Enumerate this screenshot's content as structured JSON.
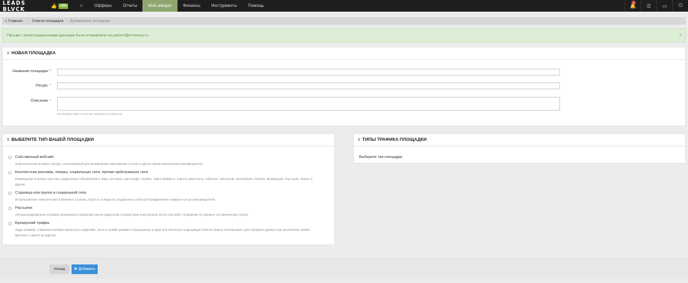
{
  "topbar": {
    "logo": "LEADS BLVCK",
    "like_pct": "+5%",
    "nav": [
      "Офферы",
      "Отчеты",
      "Мой аккаунт",
      "Финансы",
      "Инструменты",
      "Помощь"
    ],
    "notification_count": "2"
  },
  "breadcrumb": {
    "home": "Главная",
    "list": "Список площадок",
    "current": "Добавление площадки"
  },
  "alert": {
    "text": "Письмо с регистрационными данными было отправлено на partner@m-money.ru"
  },
  "new_site": {
    "title": "НОВАЯ ПЛОЩАДКА",
    "name_label": "Название площадки",
    "resource_label": "Ресурс",
    "description_label": "Описание",
    "required_mark": "*",
    "description_hint": "необходимо ввести еще как минимум 30 символов"
  },
  "site_type": {
    "title": "ВЫБЕРИТЕ ТИП ВАШЕЙ ПЛОЩАДКИ",
    "options": [
      {
        "title": "Собственный вебсайт",
        "desc": "Персональный интернет ресурс, используемый для размещения партнерских ссылок и других промо-материалов рекламодателя."
      },
      {
        "title": "Контекстная реклама, тизеры, социальные сети, прочие арбитражные сети",
        "desc": "Размещение платных текстово-графических объявлений в таких системах, как Google, Yandex, Таргет@Mail.ru, Таргеты Вконтакте, AdSense, AdvertLink, Directadvert, Gnezdo, Mediatarget, Pop under, Teaser и другие."
      },
      {
        "title": "Страница или группа в социальной сети",
        "desc": "Использование тематических публичных страниц, групп и сообществ социальных сетей для продвижения товаров и услуг рекламодателя."
      },
      {
        "title": "Рассылки",
        "desc": "Автоматизированная отправка рекламных сообщений группе адресатов посредством электронной почты или SMS сообщений по заранее составленному списку"
      },
      {
        "title": "Брокерский трафик",
        "desc": "Лиды (заявки), собранные вебмастером как в оффлайн, так и в онлайн режиме и переданные в один или несколько подходящих банков (можно использовать для передачи данных или заполнения заявок вручную с одного ip-адреса)"
      }
    ]
  },
  "traffic_types": {
    "title": "ТИПЫ ТРАФИКА ПЛОЩАДКИ",
    "body": "Выберите тип площадки"
  },
  "footer": {
    "back": "Назад",
    "add": "Добавить"
  }
}
